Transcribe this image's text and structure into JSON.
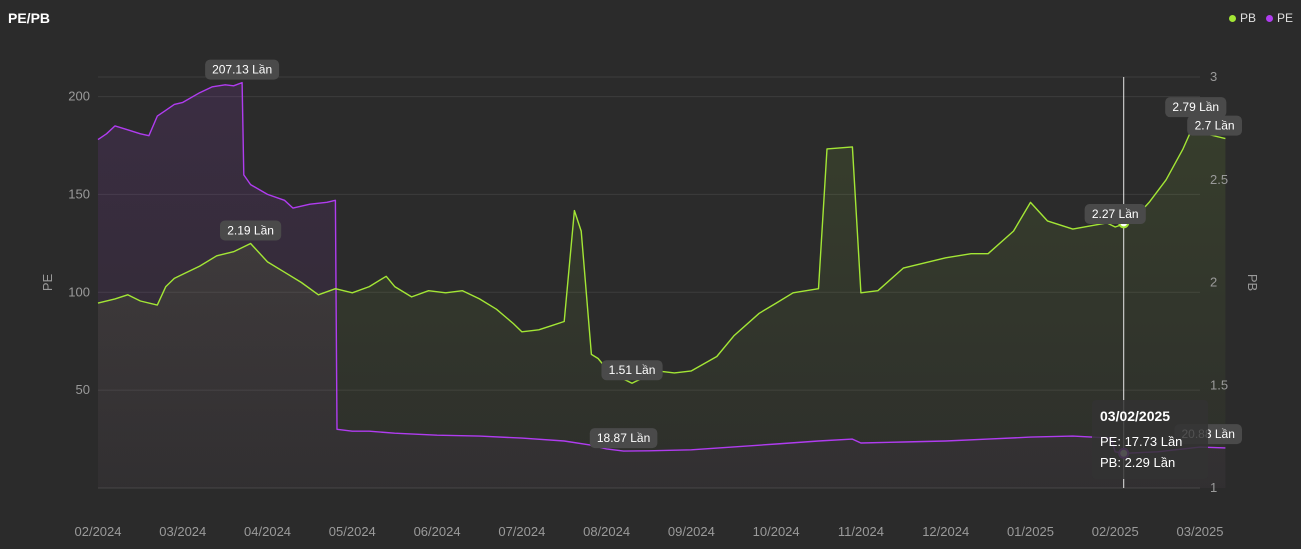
{
  "header": {
    "title": "PE/PB"
  },
  "legend": [
    {
      "name": "PB",
      "color": "#a3e635"
    },
    {
      "name": "PE",
      "color": "#b03cf0"
    }
  ],
  "tooltip": {
    "date": "03/02/2025",
    "pe": "PE: 17.73 Lần",
    "pb": "PB: 2.29 Lần"
  },
  "chart_data": {
    "type": "line",
    "x_ticks": [
      "02/2024",
      "03/2024",
      "04/2024",
      "05/2024",
      "06/2024",
      "07/2024",
      "08/2024",
      "09/2024",
      "10/2024",
      "11/2024",
      "12/2024",
      "01/2025",
      "02/2025",
      "03/2025"
    ],
    "ylabel_left": "PE",
    "ylabel_right": "PB",
    "ylim_left": [
      0,
      210
    ],
    "ylim_right": [
      1,
      3
    ],
    "yticks_left": [
      50,
      100,
      150,
      200
    ],
    "yticks_right": [
      1,
      1.5,
      2,
      2.5,
      3
    ],
    "series": [
      {
        "name": "PE",
        "axis": "left",
        "color": "#b03cf0",
        "points": [
          [
            0,
            178
          ],
          [
            0.1,
            181
          ],
          [
            0.2,
            185
          ],
          [
            0.35,
            183
          ],
          [
            0.5,
            181
          ],
          [
            0.6,
            180
          ],
          [
            0.7,
            190
          ],
          [
            0.8,
            193
          ],
          [
            0.9,
            196
          ],
          [
            1.0,
            197
          ],
          [
            1.2,
            202
          ],
          [
            1.35,
            205
          ],
          [
            1.5,
            206
          ],
          [
            1.6,
            205.5
          ],
          [
            1.7,
            207.13
          ],
          [
            1.72,
            160
          ],
          [
            1.8,
            155
          ],
          [
            2.0,
            150
          ],
          [
            2.2,
            147
          ],
          [
            2.3,
            143
          ],
          [
            2.5,
            145
          ],
          [
            2.7,
            146
          ],
          [
            2.8,
            147
          ],
          [
            2.82,
            30
          ],
          [
            3.0,
            29
          ],
          [
            3.2,
            29
          ],
          [
            3.5,
            28
          ],
          [
            4.0,
            27
          ],
          [
            4.5,
            26.5
          ],
          [
            5.0,
            25.5
          ],
          [
            5.5,
            24
          ],
          [
            5.8,
            22
          ],
          [
            6.0,
            20
          ],
          [
            6.2,
            18.87
          ],
          [
            6.5,
            19
          ],
          [
            7.0,
            19.5
          ],
          [
            7.5,
            21
          ],
          [
            8.0,
            22.5
          ],
          [
            8.5,
            24
          ],
          [
            8.9,
            25
          ],
          [
            9.0,
            23
          ],
          [
            9.5,
            23.5
          ],
          [
            10.0,
            24
          ],
          [
            10.5,
            25
          ],
          [
            11.0,
            26
          ],
          [
            11.5,
            26.5
          ],
          [
            11.95,
            25.5
          ],
          [
            12.0,
            18.5
          ],
          [
            12.1,
            17.73
          ],
          [
            12.5,
            18.5
          ],
          [
            13.0,
            20.88
          ],
          [
            13.3,
            20.5
          ]
        ]
      },
      {
        "name": "PB",
        "axis": "right",
        "color": "#a3e635",
        "points": [
          [
            0,
            1.9
          ],
          [
            0.2,
            1.92
          ],
          [
            0.35,
            1.94
          ],
          [
            0.5,
            1.91
          ],
          [
            0.7,
            1.89
          ],
          [
            0.8,
            1.98
          ],
          [
            0.9,
            2.02
          ],
          [
            1.0,
            2.04
          ],
          [
            1.2,
            2.08
          ],
          [
            1.4,
            2.13
          ],
          [
            1.6,
            2.15
          ],
          [
            1.8,
            2.19
          ],
          [
            2.0,
            2.1
          ],
          [
            2.2,
            2.05
          ],
          [
            2.4,
            2.0
          ],
          [
            2.6,
            1.94
          ],
          [
            2.8,
            1.97
          ],
          [
            3.0,
            1.95
          ],
          [
            3.2,
            1.98
          ],
          [
            3.4,
            2.03
          ],
          [
            3.5,
            1.98
          ],
          [
            3.7,
            1.93
          ],
          [
            3.9,
            1.96
          ],
          [
            4.1,
            1.95
          ],
          [
            4.3,
            1.96
          ],
          [
            4.5,
            1.92
          ],
          [
            4.7,
            1.87
          ],
          [
            4.9,
            1.8
          ],
          [
            5.0,
            1.76
          ],
          [
            5.2,
            1.77
          ],
          [
            5.35,
            1.79
          ],
          [
            5.5,
            1.81
          ],
          [
            5.62,
            2.35
          ],
          [
            5.7,
            2.25
          ],
          [
            5.82,
            1.65
          ],
          [
            5.9,
            1.63
          ],
          [
            6.0,
            1.58
          ],
          [
            6.1,
            1.55
          ],
          [
            6.3,
            1.51
          ],
          [
            6.6,
            1.57
          ],
          [
            6.8,
            1.56
          ],
          [
            7.0,
            1.57
          ],
          [
            7.3,
            1.64
          ],
          [
            7.5,
            1.74
          ],
          [
            7.8,
            1.85
          ],
          [
            8.0,
            1.9
          ],
          [
            8.2,
            1.95
          ],
          [
            8.5,
            1.97
          ],
          [
            8.6,
            2.65
          ],
          [
            8.9,
            2.66
          ],
          [
            9.0,
            1.95
          ],
          [
            9.2,
            1.96
          ],
          [
            9.5,
            2.07
          ],
          [
            10.0,
            2.12
          ],
          [
            10.3,
            2.14
          ],
          [
            10.5,
            2.14
          ],
          [
            10.8,
            2.25
          ],
          [
            11.0,
            2.39
          ],
          [
            11.2,
            2.3
          ],
          [
            11.5,
            2.26
          ],
          [
            11.9,
            2.29
          ],
          [
            12.0,
            2.27
          ],
          [
            12.2,
            2.3
          ],
          [
            12.4,
            2.39
          ],
          [
            12.6,
            2.5
          ],
          [
            12.8,
            2.65
          ],
          [
            12.95,
            2.79
          ],
          [
            13.1,
            2.72
          ],
          [
            13.3,
            2.7
          ]
        ]
      }
    ],
    "annotations": [
      {
        "series": "PE",
        "x": 1.7,
        "value": 207.13,
        "text": "207.13 Lần"
      },
      {
        "series": "PB",
        "x": 1.8,
        "value": 2.19,
        "text": "2.19 Lần"
      },
      {
        "series": "PB",
        "x": 6.3,
        "value": 1.51,
        "text": "1.51 Lần"
      },
      {
        "series": "PE",
        "x": 6.2,
        "value": 18.87,
        "text": "18.87 Lần"
      },
      {
        "series": "PB",
        "x": 12.0,
        "value": 2.27,
        "text": "2.27 Lần"
      },
      {
        "series": "PB",
        "x": 12.95,
        "value": 2.79,
        "text": "2.79 Lần"
      },
      {
        "series": "PB",
        "x": 13.3,
        "value": 2.7,
        "text": "2.7 Lần"
      },
      {
        "series": "PE",
        "x": 13.3,
        "value": 20.88,
        "text": "20.88 Lần"
      }
    ],
    "crosshair": {
      "x": 12.1,
      "pe": 17.73,
      "pb": 2.29
    },
    "grid": true,
    "legend_position": "top-right"
  }
}
